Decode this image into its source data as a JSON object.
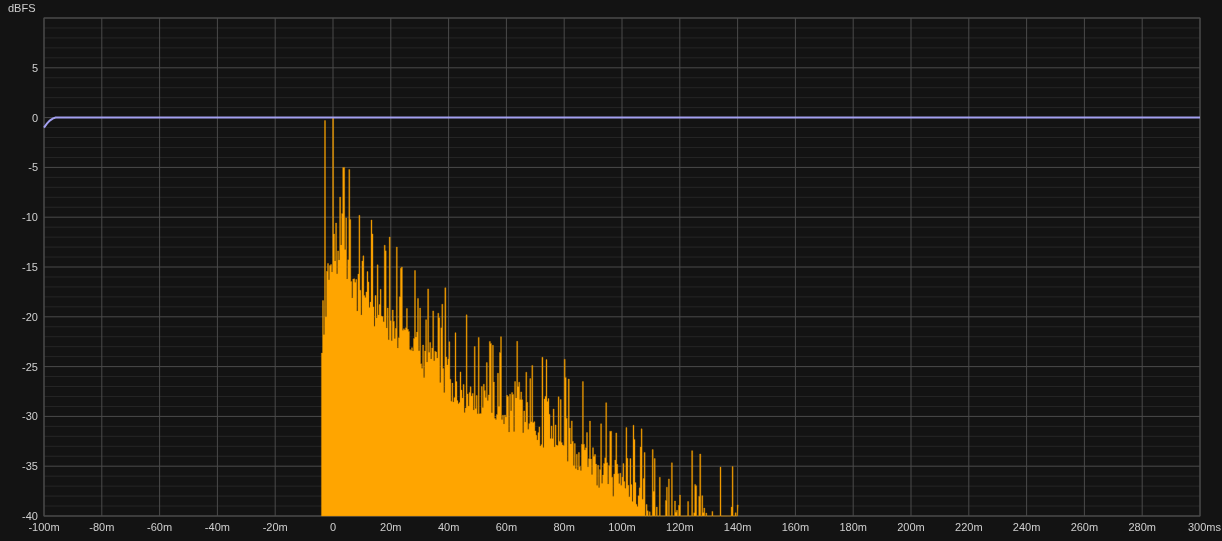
{
  "chart": {
    "chart_data": {
      "type": "line",
      "grid": true,
      "ylabel": "dBFS",
      "xlim": [
        -100,
        300
      ],
      "ylim": [
        -40,
        10
      ],
      "xticks": [
        {
          "value": -100,
          "label": "-100m"
        },
        {
          "value": -80,
          "label": "-80m"
        },
        {
          "value": -60,
          "label": "-60m"
        },
        {
          "value": -40,
          "label": "-40m"
        },
        {
          "value": -20,
          "label": "-20m"
        },
        {
          "value": 0,
          "label": "0"
        },
        {
          "value": 20,
          "label": "20m"
        },
        {
          "value": 40,
          "label": "40m"
        },
        {
          "value": 60,
          "label": "60m"
        },
        {
          "value": 80,
          "label": "80m"
        },
        {
          "value": 100,
          "label": "100m"
        },
        {
          "value": 120,
          "label": "120m"
        },
        {
          "value": 140,
          "label": "140m"
        },
        {
          "value": 160,
          "label": "160m"
        },
        {
          "value": 180,
          "label": "180m"
        },
        {
          "value": 200,
          "label": "200m"
        },
        {
          "value": 220,
          "label": "220m"
        },
        {
          "value": 240,
          "label": "240m"
        },
        {
          "value": 260,
          "label": "260m"
        },
        {
          "value": 280,
          "label": "280m"
        },
        {
          "value": 300,
          "label": "300ms"
        }
      ],
      "yticks": [
        5,
        0,
        -5,
        -10,
        -15,
        -20,
        -25,
        -30,
        -35,
        -40
      ],
      "x": [
        -100,
        -99,
        -98,
        -97,
        -96,
        -94,
        -92,
        300
      ],
      "series": [
        {
          "color": "#a3a0f0",
          "values": [
            -1,
            -0.6,
            -0.3,
            -0.1,
            0,
            0,
            0,
            0
          ]
        }
      ]
    }
  }
}
